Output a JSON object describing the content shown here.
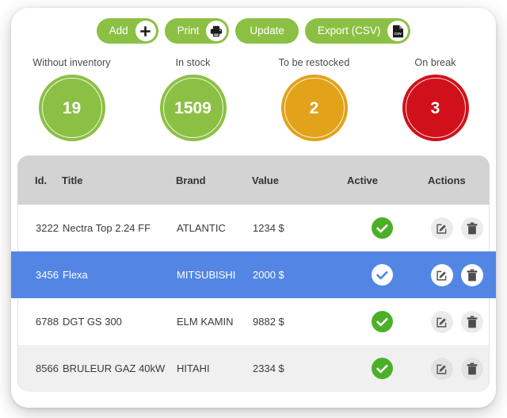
{
  "colors": {
    "green": "#8cc044",
    "check_green": "#4caf28",
    "orange": "#e2a21a",
    "red": "#d0111b",
    "selected_blue": "#5386e4",
    "header_gray": "#d3d3d3",
    "row_alt_gray": "#f0f0f0"
  },
  "toolbar": {
    "buttons": [
      {
        "label": "Add",
        "icon": "plus-icon",
        "has_icon": true
      },
      {
        "label": "Print",
        "icon": "printer-icon",
        "has_icon": true
      },
      {
        "label": "Update",
        "icon": "",
        "has_icon": false
      },
      {
        "label": "Export (CSV)",
        "icon": "csv-file-icon",
        "has_icon": true
      }
    ]
  },
  "stats": [
    {
      "label": "Without inventory",
      "value": "19",
      "color": "#8cc044"
    },
    {
      "label": "In stock",
      "value": "1509",
      "color": "#8cc044"
    },
    {
      "label": "To be restocked",
      "value": "2",
      "color": "#e2a21a"
    },
    {
      "label": "On break",
      "value": "3",
      "color": "#d0111b"
    }
  ],
  "table": {
    "columns": [
      "Id.",
      "Title",
      "Brand",
      "Value",
      "Active",
      "Actions"
    ],
    "rows": [
      {
        "id": "3222",
        "title": "Nectra Top 2.24 FF",
        "brand": "ATLANTIC",
        "value": "1234 $",
        "active": true,
        "selected": false
      },
      {
        "id": "3456",
        "title": "Flexa",
        "brand": "MITSUBISHI",
        "value": "2000 $",
        "active": true,
        "selected": true
      },
      {
        "id": "6788",
        "title": "DGT GS 300",
        "brand": "ELM KAMIN",
        "value": "9882 $",
        "active": true,
        "selected": false
      },
      {
        "id": "8566",
        "title": "BRULEUR GAZ 40kW",
        "brand": "HITAHI",
        "value": "2334 $",
        "active": true,
        "selected": false
      }
    ],
    "actions": [
      {
        "name": "edit-icon",
        "label": "Edit"
      },
      {
        "name": "trash-icon",
        "label": "Delete"
      }
    ]
  }
}
